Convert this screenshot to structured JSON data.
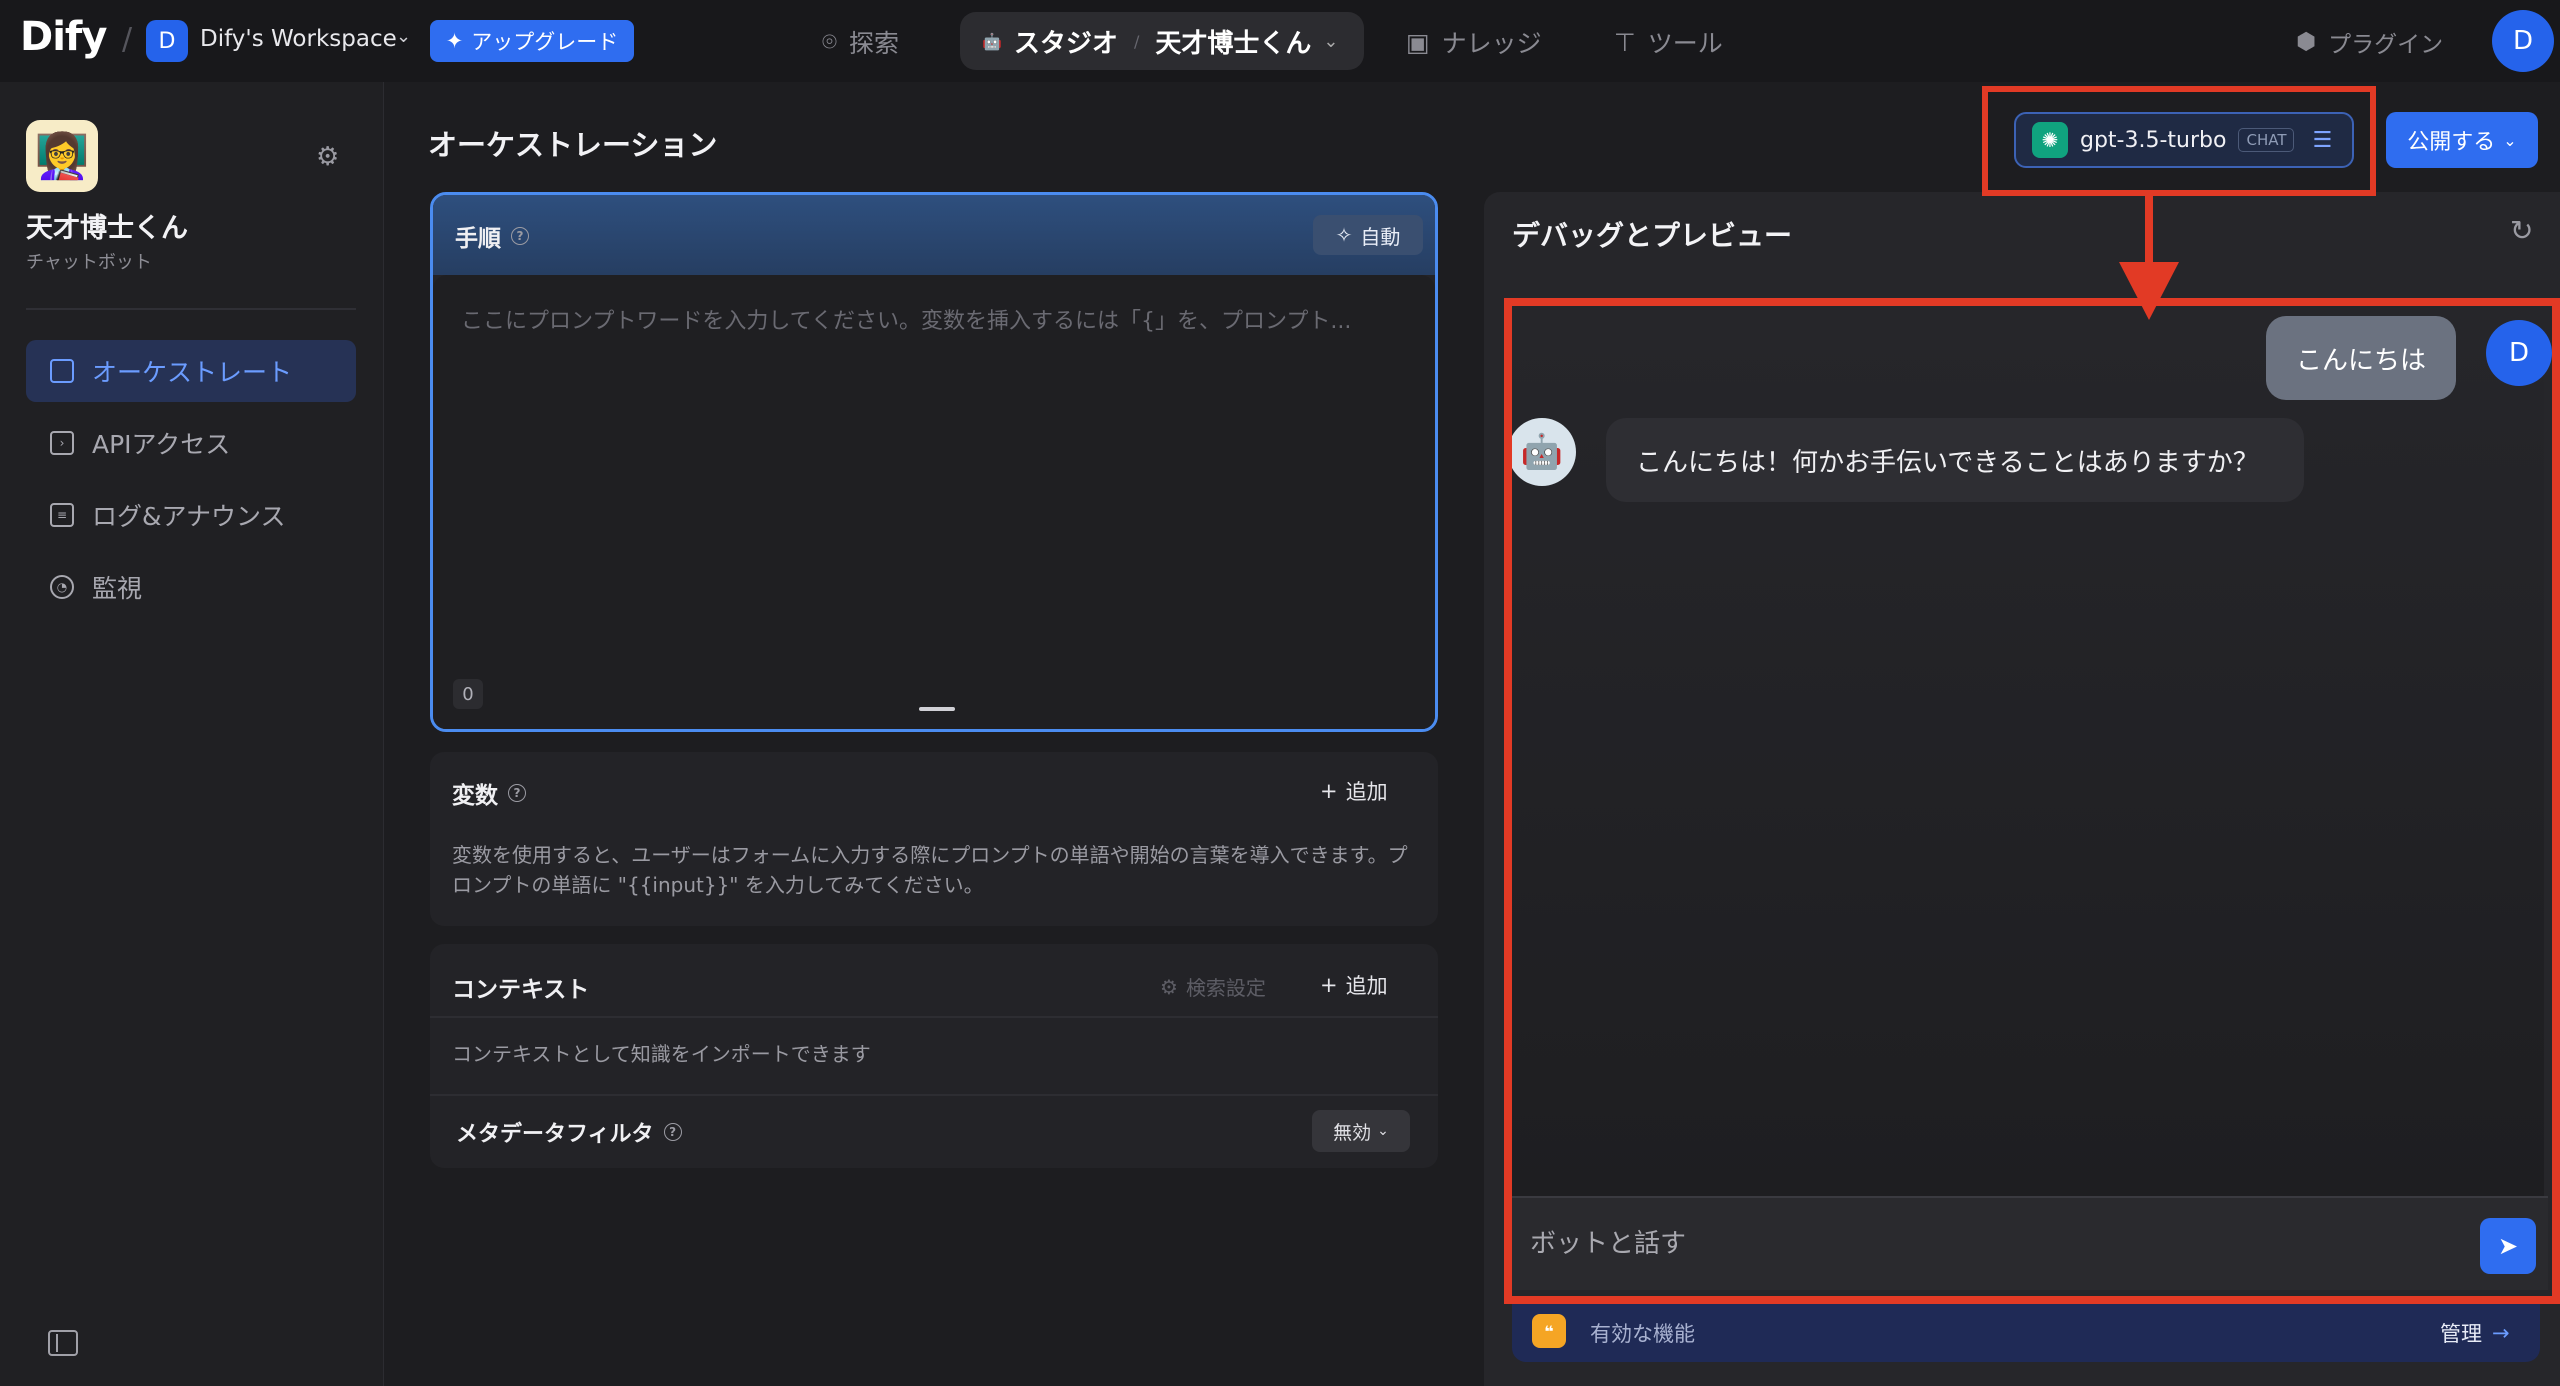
{
  "topbar": {
    "logo": "Dify",
    "workspace_initial": "D",
    "workspace_name": "Dify's Workspace",
    "upgrade_label": "アップグレード",
    "nav": {
      "explore": "探索",
      "studio": "スタジオ",
      "app_name": "天才博士くん",
      "knowledge": "ナレッジ",
      "tools": "ツール",
      "plugins": "プラグイン"
    },
    "user_initial": "D"
  },
  "sidebar": {
    "app_name": "天才博士くん",
    "app_type": "チャットボット",
    "items": [
      {
        "label": "オーケストレート",
        "active": true
      },
      {
        "label": "APIアクセス"
      },
      {
        "label": "ログ&アナウンス"
      },
      {
        "label": "監視"
      }
    ]
  },
  "main": {
    "title": "オーケストレーション",
    "prompt": {
      "label": "手順",
      "auto_label": "自動",
      "placeholder": "ここにプロンプトワードを入力してください。変数を挿入するには「{」を、プロンプト...",
      "count": "0"
    },
    "variables": {
      "title": "変数",
      "add_label": "追加",
      "description": "変数を使用すると、ユーザーはフォームに入力する際にプロンプトの単語や開始の言葉を導入できます。プロンプトの単語に \"{{input}}\" を入力してみてください。"
    },
    "context": {
      "title": "コンテキスト",
      "search_settings": "検索設定",
      "add_label": "追加",
      "description": "コンテキストとして知識をインポートできます",
      "metadata_filter": "メタデータフィルタ",
      "metadata_value": "無効"
    }
  },
  "header_controls": {
    "model_name": "gpt-3.5-turbo",
    "model_mode": "CHAT",
    "publish_label": "公開する"
  },
  "debug": {
    "title": "デバッグとプレビュー",
    "messages": [
      {
        "role": "user",
        "text": "こんにちは"
      },
      {
        "role": "assistant",
        "text": "こんにちは！何かお手伝いできることはありますか？"
      }
    ],
    "user_initial": "D",
    "input_placeholder": "ボットと話す",
    "features_label": "有効な機能",
    "manage_label": "管理"
  },
  "colors": {
    "accent": "#2f6df0",
    "highlight": "#e23a25",
    "background": "#1d1d20"
  }
}
